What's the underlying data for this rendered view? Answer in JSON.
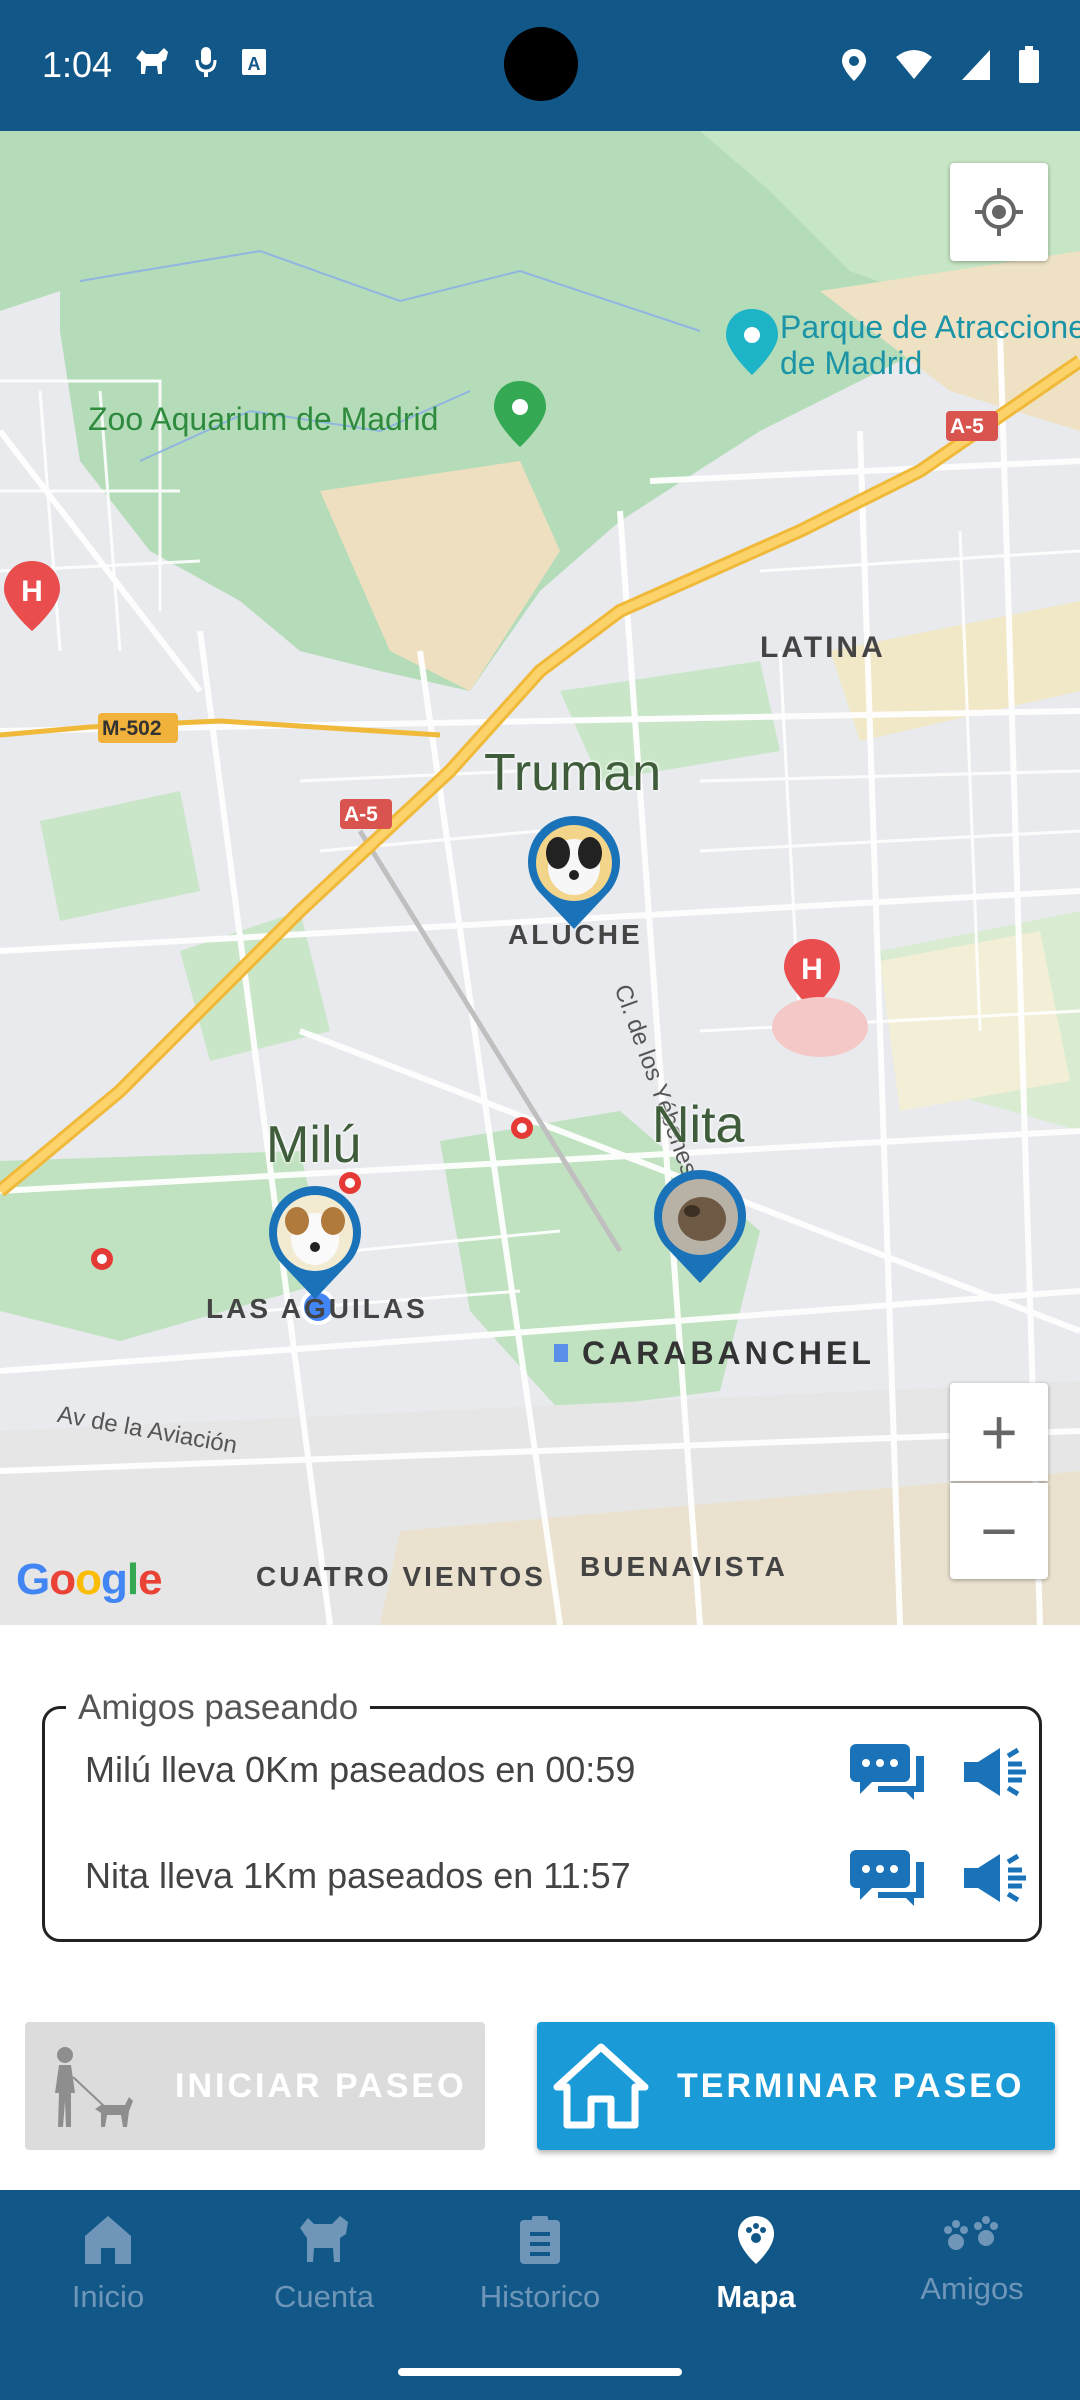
{
  "status_bar": {
    "time": "1:04",
    "left_icons": [
      "dog-app-icon",
      "mic-icon",
      "text-icon"
    ],
    "right_icons": [
      "location-icon",
      "wifi-icon",
      "signal-icon",
      "battery-icon"
    ]
  },
  "map": {
    "labels": {
      "parque": "Parque de Atracciones\nde Madrid",
      "zoo": "Zoo Aquarium de Madrid",
      "latina": "LATINA",
      "m502": "M-502",
      "a5_top": "A-5",
      "a5_mid": "A-5",
      "yebenes": "Cl. de los Yébenes",
      "aluche": "ALUCHE",
      "las_aguilas": "LAS AGUILAS",
      "carabanchel": "CARABANCHEL",
      "aviacion": "Av de la Aviación",
      "cuatro_vientos": "CUATRO VIENTOS",
      "buenavista": "BUENAVISTA",
      "google": "Google"
    },
    "pets": [
      {
        "name": "Truman"
      },
      {
        "name": "Milú"
      },
      {
        "name": "Nita"
      }
    ],
    "zoom_in": "+",
    "zoom_out": "−"
  },
  "friends": {
    "legend": "Amigos paseando",
    "rows": [
      {
        "text": "Milú lleva 0Km paseados en 00:59"
      },
      {
        "text": "Nita lleva 1Km paseados en 11:57"
      }
    ]
  },
  "actions": {
    "start_label": "INICIAR PASEO",
    "end_label": "TERMINAR PASEO"
  },
  "nav": {
    "items": [
      {
        "label": "Inicio"
      },
      {
        "label": "Cuenta"
      },
      {
        "label": "Historico"
      },
      {
        "label": "Mapa"
      },
      {
        "label": "Amigos"
      }
    ]
  },
  "colors": {
    "primary_dark": "#115889",
    "accent": "#1a9bd7",
    "icon_blue": "#1a73b8"
  }
}
